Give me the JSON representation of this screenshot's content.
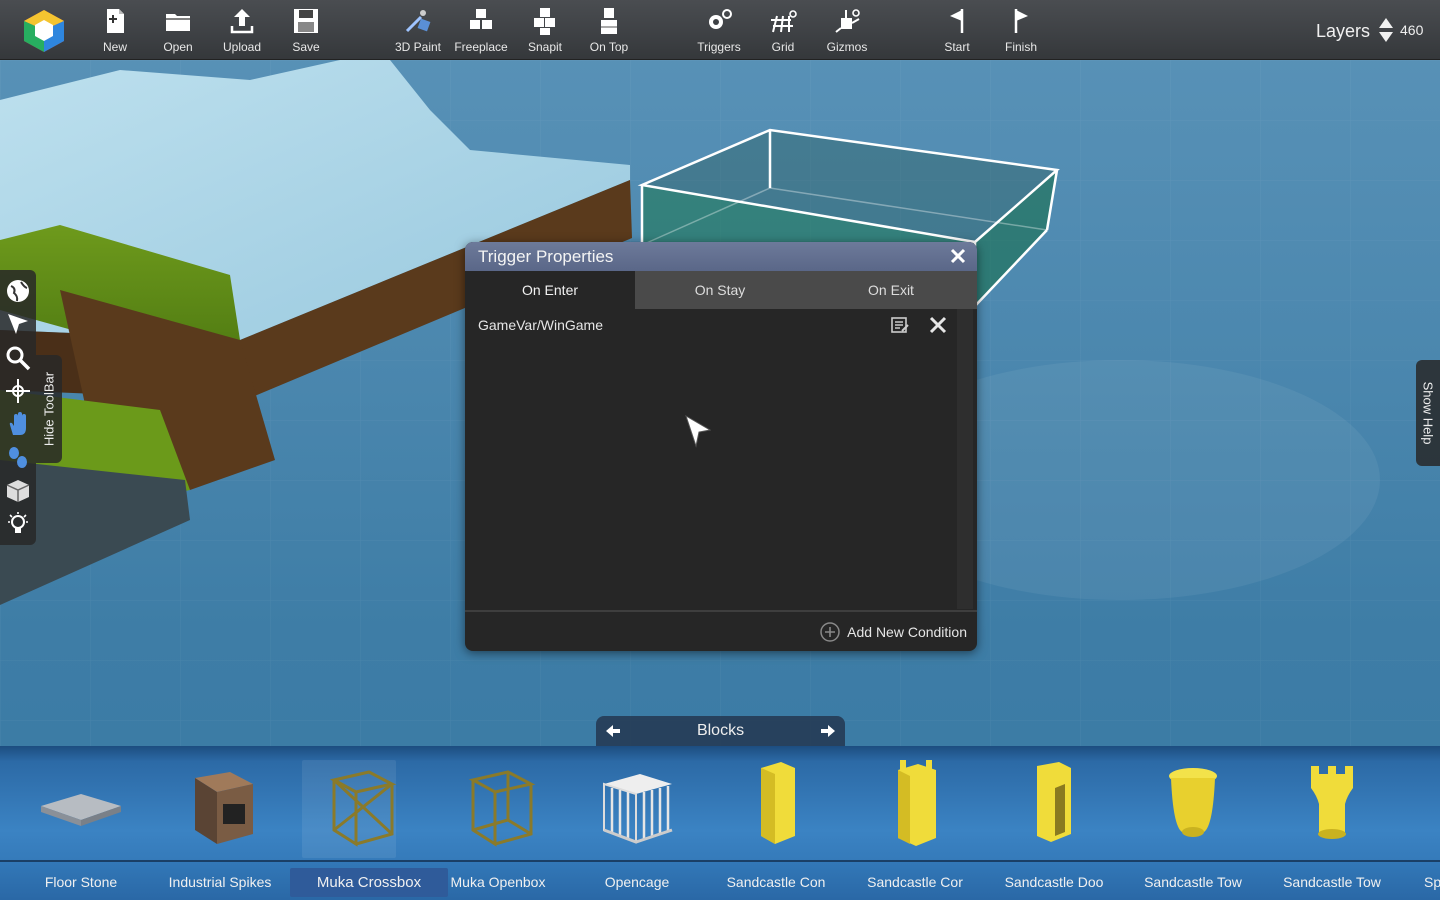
{
  "toolbar": {
    "logo_icon": "app-logo-cube",
    "buttons": [
      {
        "label": "New",
        "icon": "new-file-icon"
      },
      {
        "label": "Open",
        "icon": "folder-icon"
      },
      {
        "label": "Upload",
        "icon": "upload-icon"
      },
      {
        "label": "Save",
        "icon": "save-icon"
      },
      {
        "label": "3D Paint",
        "icon": "paint-icon"
      },
      {
        "label": "Freeplace",
        "icon": "cubes-icon"
      },
      {
        "label": "Snapit",
        "icon": "snap-cubes-icon"
      },
      {
        "label": "On Top",
        "icon": "stack-cube-icon"
      },
      {
        "label": "Triggers",
        "icon": "gears-icon"
      },
      {
        "label": "Grid",
        "icon": "grid-icon"
      },
      {
        "label": "Gizmos",
        "icon": "gizmo-icon"
      },
      {
        "label": "Start",
        "icon": "start-flag-icon"
      },
      {
        "label": "Finish",
        "icon": "finish-flag-icon"
      }
    ],
    "layers": {
      "label": "Layers",
      "value": "460"
    }
  },
  "left_tools": [
    "globe-icon",
    "pointer-icon",
    "search-icon",
    "move-icon",
    "hand-icon",
    "footsteps-icon",
    "box-icon",
    "lightbulb-icon"
  ],
  "hide_toolbar_label": "Hide ToolBar",
  "show_help_label": "Show Help",
  "dialog": {
    "title": "Trigger Properties",
    "tabs": [
      {
        "label": "On Enter",
        "active": true
      },
      {
        "label": "On Stay",
        "active": false
      },
      {
        "label": "On Exit",
        "active": false
      }
    ],
    "conditions": [
      {
        "text": "GameVar/WinGame"
      }
    ],
    "add_label": "Add New Condition"
  },
  "category": {
    "label": "Blocks"
  },
  "palette": {
    "items": [
      {
        "name": "Floor Stone",
        "selected": false
      },
      {
        "name": "Industrial Spikes",
        "selected": false
      },
      {
        "name": "Muka Crossbox",
        "selected": true
      },
      {
        "name": "Muka Openbox",
        "selected": false
      },
      {
        "name": "Opencage",
        "selected": false
      },
      {
        "name": "Sandcastle Con",
        "selected": false
      },
      {
        "name": "Sandcastle Cor",
        "selected": false
      },
      {
        "name": "Sandcastle Doo",
        "selected": false
      },
      {
        "name": "Sandcastle Tow",
        "selected": false
      },
      {
        "name": "Sandcastle Tow",
        "selected": false
      },
      {
        "name": "Sp",
        "selected": false
      }
    ]
  },
  "colors": {
    "toolbar_bg": "#3d4044",
    "dialog_title": "#66739a",
    "palette_bg": "#3b83c3",
    "selected_label": "#2f5b9a"
  }
}
